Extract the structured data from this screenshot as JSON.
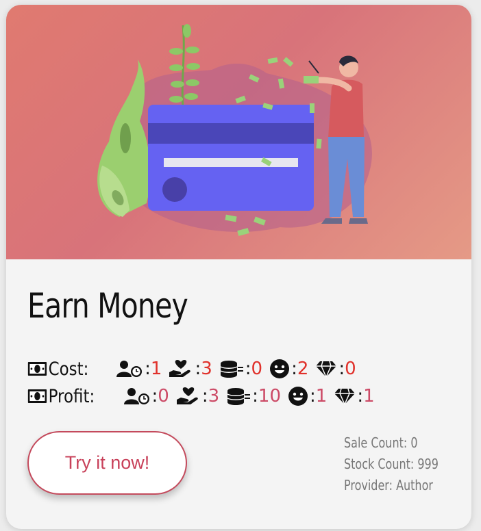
{
  "card": {
    "title": "Earn Money",
    "button_label": "Try it now!",
    "cost": {
      "label": "Cost:",
      "stats": [
        {
          "icon": "user-clock-icon",
          "value": "1"
        },
        {
          "icon": "hand-heart-icon",
          "value": "3"
        },
        {
          "icon": "coins-icon",
          "value": "0"
        },
        {
          "icon": "smile-icon",
          "value": "2"
        },
        {
          "icon": "gem-icon",
          "value": "0"
        }
      ]
    },
    "profit": {
      "label": "Profit:",
      "stats": [
        {
          "icon": "user-clock-icon",
          "value": "0"
        },
        {
          "icon": "hand-heart-icon",
          "value": "3"
        },
        {
          "icon": "coins-icon",
          "value": "10"
        },
        {
          "icon": "smile-icon",
          "value": "1"
        },
        {
          "icon": "gem-icon",
          "value": "1"
        }
      ]
    },
    "meta": {
      "sale_count": "Sale Count: 0",
      "stock_count": "Stock Count: 999",
      "provider": "Provider: Author"
    },
    "colors": {
      "cost_value": "#e0312b",
      "profit_value": "#cc4a66",
      "button_accent": "#c8415a",
      "hero_bg": "#dd7873"
    }
  }
}
